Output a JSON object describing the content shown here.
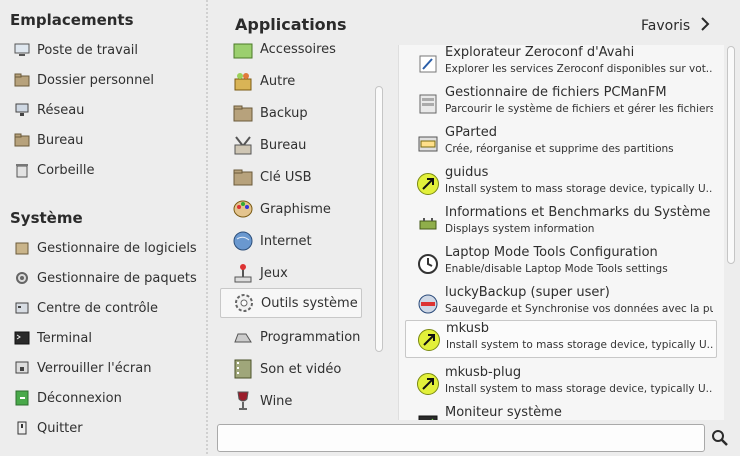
{
  "places": {
    "title": "Emplacements",
    "items": [
      {
        "label": "Poste de travail"
      },
      {
        "label": "Dossier personnel"
      },
      {
        "label": "Réseau"
      },
      {
        "label": "Bureau"
      },
      {
        "label": "Corbeille"
      }
    ]
  },
  "system": {
    "title": "Système",
    "items": [
      {
        "label": "Gestionnaire de logiciels"
      },
      {
        "label": "Gestionnaire de paquets"
      },
      {
        "label": "Centre de contrôle"
      },
      {
        "label": "Terminal"
      },
      {
        "label": "Verrouiller l'écran"
      },
      {
        "label": "Déconnexion"
      },
      {
        "label": "Quitter"
      }
    ]
  },
  "header": {
    "applications": "Applications",
    "favoris": "Favoris"
  },
  "categories": [
    {
      "label": "Accessoires"
    },
    {
      "label": "Autre"
    },
    {
      "label": "Backup"
    },
    {
      "label": "Bureau"
    },
    {
      "label": "Clé USB"
    },
    {
      "label": "Graphisme"
    },
    {
      "label": "Internet"
    },
    {
      "label": "Jeux"
    },
    {
      "label": "Outils système",
      "active": true
    },
    {
      "label": "Programmation"
    },
    {
      "label": "Son et vidéo"
    },
    {
      "label": "Wine"
    }
  ],
  "apps": [
    {
      "title": "Explorateur Zeroconf d'Avahi",
      "desc": "Explorer les services Zeroconf disponibles sur vot..."
    },
    {
      "title": "Gestionnaire de fichiers PCManFM",
      "desc": "Parcourir le système de fichiers et gérer les fichiers"
    },
    {
      "title": "GParted",
      "desc": "Crée, réorganise et supprime des partitions"
    },
    {
      "title": "guidus",
      "desc": "Install system to mass storage device, typically U..."
    },
    {
      "title": "Informations et Benchmarks du Système",
      "desc": "Displays system information"
    },
    {
      "title": "Laptop Mode Tools Configuration",
      "desc": "Enable/disable Laptop Mode Tools settings"
    },
    {
      "title": "luckyBackup (super user)",
      "desc": "Sauvegarde et Synchronise vos données avec la pu..."
    },
    {
      "title": "mkusb",
      "desc": "Install system to mass storage device, typically U...",
      "active": true
    },
    {
      "title": "mkusb-plug",
      "desc": "Install system to mass storage device, typically U..."
    },
    {
      "title": "Moniteur système",
      "desc": ""
    }
  ],
  "search": {
    "value": "",
    "placeholder": ""
  }
}
